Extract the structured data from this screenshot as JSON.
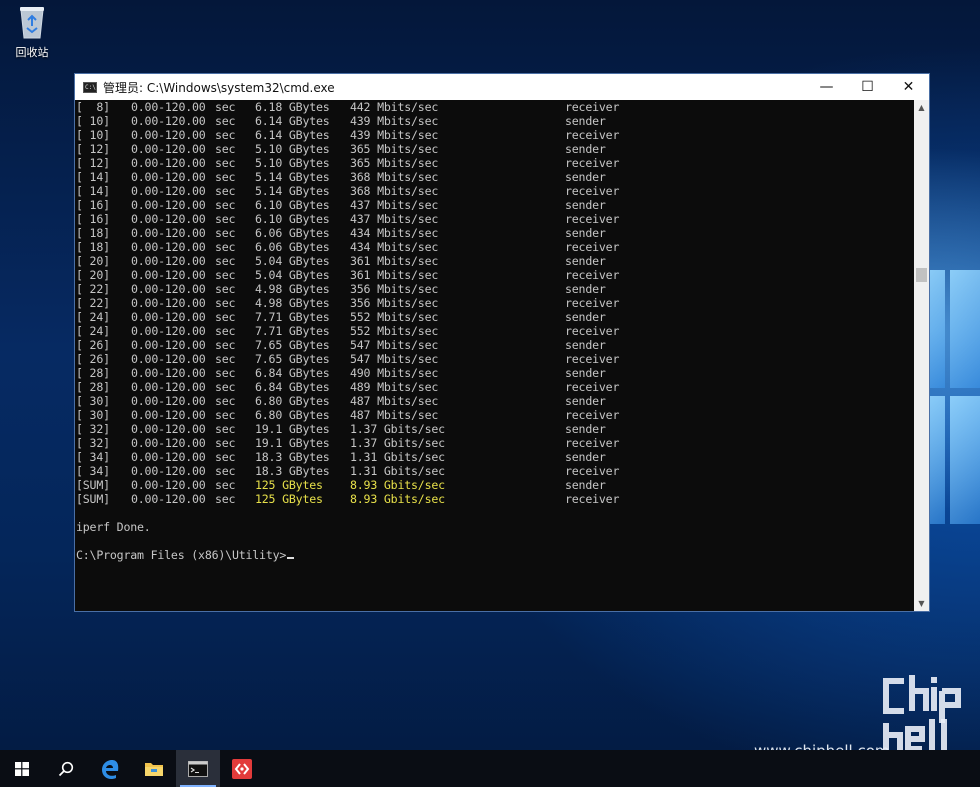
{
  "desktop": {
    "recycle_bin_label": "回收站"
  },
  "window": {
    "title": "管理员: C:\\Windows\\system32\\cmd.exe",
    "icon_text": "C:\\",
    "minimize_glyph": "—",
    "maximize_glyph": "☐",
    "close_glyph": "✕"
  },
  "console": {
    "rows": [
      {
        "id": "[  8]",
        "interval": "0.00-120.00",
        "unit": "sec",
        "transfer": "6.18 GBytes",
        "bandwidth": "442 Mbits/sec",
        "role": "receiver"
      },
      {
        "id": "[ 10]",
        "interval": "0.00-120.00",
        "unit": "sec",
        "transfer": "6.14 GBytes",
        "bandwidth": "439 Mbits/sec",
        "role": "sender"
      },
      {
        "id": "[ 10]",
        "interval": "0.00-120.00",
        "unit": "sec",
        "transfer": "6.14 GBytes",
        "bandwidth": "439 Mbits/sec",
        "role": "receiver"
      },
      {
        "id": "[ 12]",
        "interval": "0.00-120.00",
        "unit": "sec",
        "transfer": "5.10 GBytes",
        "bandwidth": "365 Mbits/sec",
        "role": "sender"
      },
      {
        "id": "[ 12]",
        "interval": "0.00-120.00",
        "unit": "sec",
        "transfer": "5.10 GBytes",
        "bandwidth": "365 Mbits/sec",
        "role": "receiver"
      },
      {
        "id": "[ 14]",
        "interval": "0.00-120.00",
        "unit": "sec",
        "transfer": "5.14 GBytes",
        "bandwidth": "368 Mbits/sec",
        "role": "sender"
      },
      {
        "id": "[ 14]",
        "interval": "0.00-120.00",
        "unit": "sec",
        "transfer": "5.14 GBytes",
        "bandwidth": "368 Mbits/sec",
        "role": "receiver"
      },
      {
        "id": "[ 16]",
        "interval": "0.00-120.00",
        "unit": "sec",
        "transfer": "6.10 GBytes",
        "bandwidth": "437 Mbits/sec",
        "role": "sender"
      },
      {
        "id": "[ 16]",
        "interval": "0.00-120.00",
        "unit": "sec",
        "transfer": "6.10 GBytes",
        "bandwidth": "437 Mbits/sec",
        "role": "receiver"
      },
      {
        "id": "[ 18]",
        "interval": "0.00-120.00",
        "unit": "sec",
        "transfer": "6.06 GBytes",
        "bandwidth": "434 Mbits/sec",
        "role": "sender"
      },
      {
        "id": "[ 18]",
        "interval": "0.00-120.00",
        "unit": "sec",
        "transfer": "6.06 GBytes",
        "bandwidth": "434 Mbits/sec",
        "role": "receiver"
      },
      {
        "id": "[ 20]",
        "interval": "0.00-120.00",
        "unit": "sec",
        "transfer": "5.04 GBytes",
        "bandwidth": "361 Mbits/sec",
        "role": "sender"
      },
      {
        "id": "[ 20]",
        "interval": "0.00-120.00",
        "unit": "sec",
        "transfer": "5.04 GBytes",
        "bandwidth": "361 Mbits/sec",
        "role": "receiver"
      },
      {
        "id": "[ 22]",
        "interval": "0.00-120.00",
        "unit": "sec",
        "transfer": "4.98 GBytes",
        "bandwidth": "356 Mbits/sec",
        "role": "sender"
      },
      {
        "id": "[ 22]",
        "interval": "0.00-120.00",
        "unit": "sec",
        "transfer": "4.98 GBytes",
        "bandwidth": "356 Mbits/sec",
        "role": "receiver"
      },
      {
        "id": "[ 24]",
        "interval": "0.00-120.00",
        "unit": "sec",
        "transfer": "7.71 GBytes",
        "bandwidth": "552 Mbits/sec",
        "role": "sender"
      },
      {
        "id": "[ 24]",
        "interval": "0.00-120.00",
        "unit": "sec",
        "transfer": "7.71 GBytes",
        "bandwidth": "552 Mbits/sec",
        "role": "receiver"
      },
      {
        "id": "[ 26]",
        "interval": "0.00-120.00",
        "unit": "sec",
        "transfer": "7.65 GBytes",
        "bandwidth": "547 Mbits/sec",
        "role": "sender"
      },
      {
        "id": "[ 26]",
        "interval": "0.00-120.00",
        "unit": "sec",
        "transfer": "7.65 GBytes",
        "bandwidth": "547 Mbits/sec",
        "role": "receiver"
      },
      {
        "id": "[ 28]",
        "interval": "0.00-120.00",
        "unit": "sec",
        "transfer": "6.84 GBytes",
        "bandwidth": "490 Mbits/sec",
        "role": "sender"
      },
      {
        "id": "[ 28]",
        "interval": "0.00-120.00",
        "unit": "sec",
        "transfer": "6.84 GBytes",
        "bandwidth": "489 Mbits/sec",
        "role": "receiver"
      },
      {
        "id": "[ 30]",
        "interval": "0.00-120.00",
        "unit": "sec",
        "transfer": "6.80 GBytes",
        "bandwidth": "487 Mbits/sec",
        "role": "sender"
      },
      {
        "id": "[ 30]",
        "interval": "0.00-120.00",
        "unit": "sec",
        "transfer": "6.80 GBytes",
        "bandwidth": "487 Mbits/sec",
        "role": "receiver"
      },
      {
        "id": "[ 32]",
        "interval": "0.00-120.00",
        "unit": "sec",
        "transfer": "19.1 GBytes",
        "bandwidth": "1.37 Gbits/sec",
        "role": "sender"
      },
      {
        "id": "[ 32]",
        "interval": "0.00-120.00",
        "unit": "sec",
        "transfer": "19.1 GBytes",
        "bandwidth": "1.37 Gbits/sec",
        "role": "receiver"
      },
      {
        "id": "[ 34]",
        "interval": "0.00-120.00",
        "unit": "sec",
        "transfer": "18.3 GBytes",
        "bandwidth": "1.31 Gbits/sec",
        "role": "sender"
      },
      {
        "id": "[ 34]",
        "interval": "0.00-120.00",
        "unit": "sec",
        "transfer": "18.3 GBytes",
        "bandwidth": "1.31 Gbits/sec",
        "role": "receiver"
      },
      {
        "id": "[SUM]",
        "interval": "0.00-120.00",
        "unit": "sec",
        "transfer": "125 GBytes",
        "bandwidth": "8.93 Gbits/sec",
        "role": "sender",
        "highlight": true
      },
      {
        "id": "[SUM]",
        "interval": "0.00-120.00",
        "unit": "sec",
        "transfer": "125 GBytes",
        "bandwidth": "8.93 Gbits/sec",
        "role": "receiver",
        "highlight": true
      }
    ],
    "done_text": "iperf Done.",
    "prompt_text": "C:\\Program Files (x86)\\Utility>",
    "highlight_color": "#e7e04a"
  },
  "taskbar": {
    "items": [
      "start-icon",
      "search-icon",
      "edge-icon",
      "file-explorer-icon",
      "cmd-icon",
      "app-icon"
    ]
  },
  "watermark": {
    "url": "www.chiphell.com",
    "logo_text": "chiphell"
  }
}
